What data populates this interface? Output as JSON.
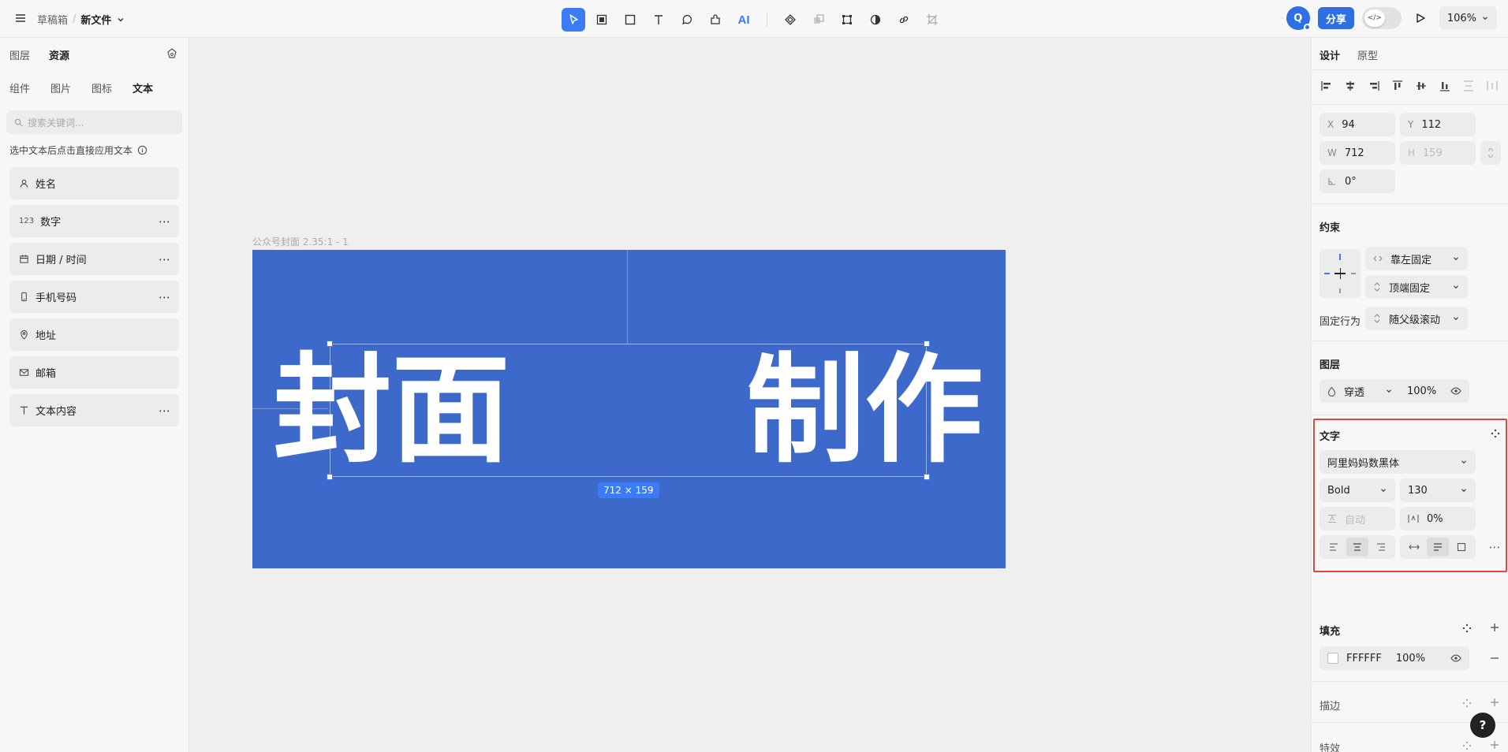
{
  "breadcrumb": {
    "project": "草稿箱",
    "separator": "/",
    "file": "新文件"
  },
  "toolbar": {
    "ai_label": "AI"
  },
  "topright": {
    "avatar_initial": "Q",
    "share_label": "分享",
    "code_toggle": "</>",
    "zoom": "106%"
  },
  "left": {
    "tabs": [
      "图层",
      "资源"
    ],
    "subtabs": [
      "组件",
      "图片",
      "图标",
      "文本"
    ],
    "search_placeholder": "搜索关键词...",
    "hint": "选中文本后点击直接应用文本",
    "items": [
      {
        "label": "姓名",
        "icon": "person-icon",
        "more": false
      },
      {
        "label": "数字",
        "icon": "number-icon",
        "prefix": "123",
        "more": true
      },
      {
        "label": "日期 / 时间",
        "icon": "calendar-icon",
        "more": true
      },
      {
        "label": "手机号码",
        "icon": "phone-icon",
        "more": true
      },
      {
        "label": "地址",
        "icon": "location-icon",
        "more": false
      },
      {
        "label": "邮箱",
        "icon": "mail-icon",
        "more": false
      },
      {
        "label": "文本内容",
        "icon": "text-icon",
        "more": true
      }
    ]
  },
  "canvas": {
    "frame_label": "公众号封面 2.35:1 - 1",
    "frame_color": "#3D69CB",
    "text": "封面　　制作",
    "dimension_badge": "712 × 159"
  },
  "right": {
    "tabs": [
      "设计",
      "原型"
    ],
    "x": {
      "key": "X",
      "value": "94"
    },
    "y": {
      "key": "Y",
      "value": "112"
    },
    "w": {
      "key": "W",
      "value": "712"
    },
    "h": {
      "key": "H",
      "value": "159"
    },
    "rotation": "0°",
    "constraints": {
      "title": "约束",
      "horizontal": "靠左固定",
      "vertical": "顶端固定"
    },
    "fixed": {
      "label": "固定行为",
      "value": "随父级滚动"
    },
    "layer": {
      "title": "图层",
      "blend": "穿透",
      "opacity": "100%"
    },
    "text": {
      "title": "文字",
      "font": "阿里妈妈数黑体",
      "weight": "Bold",
      "size": "130",
      "line_height": "自动",
      "letter_spacing": "0%"
    },
    "fill": {
      "title": "填充",
      "hex": "FFFFFF",
      "opacity": "100%"
    },
    "stroke": {
      "title": "描边"
    },
    "effects": {
      "title": "特效"
    },
    "help": "?"
  },
  "colors": {
    "accent": "#3B7CF6",
    "highlight": "#E0473A"
  }
}
